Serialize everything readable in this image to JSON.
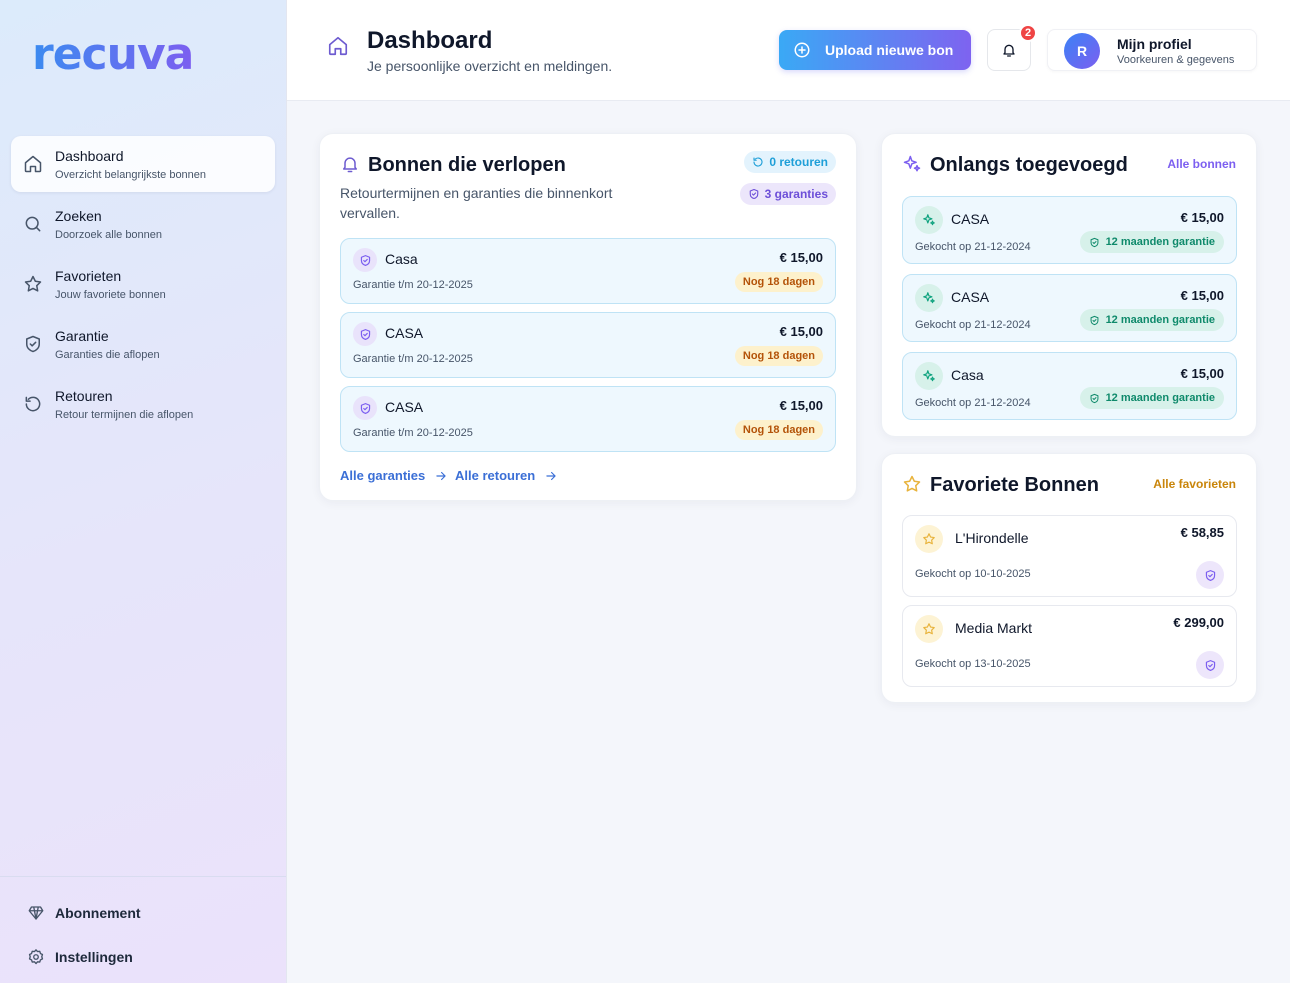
{
  "app": {
    "logo": "recuva"
  },
  "sidebar": {
    "items": [
      {
        "label": "Dashboard",
        "sub": "Overzicht belangrijkste bonnen",
        "icon": "home-icon"
      },
      {
        "label": "Zoeken",
        "sub": "Doorzoek alle bonnen",
        "icon": "search-icon"
      },
      {
        "label": "Favorieten",
        "sub": "Jouw favoriete bonnen",
        "icon": "star-icon"
      },
      {
        "label": "Garantie",
        "sub": "Garanties die aflopen",
        "icon": "shield-icon"
      },
      {
        "label": "Retouren",
        "sub": "Retour termijnen die aflopen",
        "icon": "undo-icon"
      }
    ],
    "bottom": [
      {
        "label": "Abonnement",
        "icon": "diamond-icon"
      },
      {
        "label": "Instellingen",
        "icon": "gear-icon"
      }
    ]
  },
  "header": {
    "title": "Dashboard",
    "subtitle": "Je persoonlijke overzicht en meldingen.",
    "upload_label": "Upload nieuwe bon",
    "notification_count": "2",
    "profile": {
      "initial": "R",
      "name": "Mijn profiel",
      "sub": "Voorkeuren & gegevens"
    }
  },
  "expiring": {
    "title": "Bonnen die verlopen",
    "desc": "Retourtermijnen en garanties die binnenkort vervallen.",
    "returns_pill": "0 retouren",
    "warranty_pill": "3 garanties",
    "items": [
      {
        "name": "Casa",
        "date": "Garantie t/m 20-12-2025",
        "price": "€ 15,00",
        "days": "Nog 18 dagen"
      },
      {
        "name": "CASA",
        "date": "Garantie t/m 20-12-2025",
        "price": "€ 15,00",
        "days": "Nog 18 dagen"
      },
      {
        "name": "CASA",
        "date": "Garantie t/m 20-12-2025",
        "price": "€ 15,00",
        "days": "Nog 18 dagen"
      }
    ],
    "link_warranties": "Alle garanties",
    "link_returns": "Alle retouren"
  },
  "recent": {
    "title": "Onlangs toegevoegd",
    "link": "Alle bonnen",
    "items": [
      {
        "name": "CASA",
        "date": "Gekocht op 21-12-2024",
        "price": "€ 15,00",
        "warranty": "12 maanden garantie"
      },
      {
        "name": "CASA",
        "date": "Gekocht op 21-12-2024",
        "price": "€ 15,00",
        "warranty": "12 maanden garantie"
      },
      {
        "name": "Casa",
        "date": "Gekocht op 21-12-2024",
        "price": "€ 15,00",
        "warranty": "12 maanden garantie"
      }
    ]
  },
  "favorites": {
    "title": "Favoriete Bonnen",
    "link": "Alle favorieten",
    "items": [
      {
        "name": "L'Hirondelle",
        "date": "Gekocht op 10-10-2025",
        "price": "€ 58,85"
      },
      {
        "name": "Media Markt",
        "date": "Gekocht op 13-10-2025",
        "price": "€ 299,00"
      }
    ]
  },
  "colors": {
    "accent": "#7c5ff0",
    "link_blue": "#3b6fd6",
    "warning_bg": "#fdf1cc",
    "success": "#0f8a6b",
    "favorite_gold": "#c9850a"
  }
}
